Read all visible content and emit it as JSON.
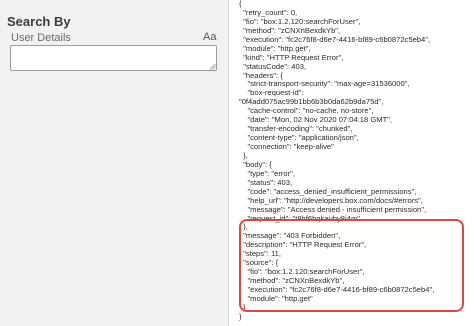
{
  "search_panel": {
    "title": "Search By",
    "field_label": "User Details",
    "case_toggle": "Aa",
    "input_value": ""
  },
  "response_lines": [
    "{",
    "  \"retry_count\": 0,",
    "  \"fio\": \"box:1.2.120:searchForUser\",",
    "  \"method\": \"zCNXnBexdkYb\",",
    "  \"execution\": \"fc2c76f8-d6e7-4416-bf89-c6b0872c5eb4\",",
    "  \"module\": \"http.get\",",
    "  \"kind\": \"HTTP Request Error\",",
    "  \"statusCode\": 403,",
    "  \"headers\": {",
    "    \"strict-transport-security\": \"max-age=31536000\",",
    "    \"box-request-id\":",
    "\"0f4add075ac99b1bb6b3b0da62b9da75d\",",
    "    \"cache-control\": \"no-cache, no-store\",",
    "    \"date\": \"Mon, 02 Nov 2020 07:04:18 GMT\",",
    "    \"transfer-encoding\": \"chunked\",",
    "    \"content-type\": \"application/json\",",
    "    \"connection\": \"keep-alive\"",
    "  },",
    "  \"body\": {",
    "    \"type\": \"error\",",
    "    \"status\": 403,",
    "    \"code\": \"access_denied_insufficient_permissions\",",
    "    \"help_url\": \"http://developers.box.com/docs/#errors\",",
    "    \"message\": \"Access denied - insufficient permission\",",
    "    \"request_id\": \"t8hf6bqkauby8i4m\"",
    "  },",
    "  \"message\": \"403 Forbidden\",",
    "  \"description\": \"HTTP Request Error\",",
    "  \"steps\": 11,",
    "  \"source\": {",
    "    \"fio\": \"box:1.2.120:searchForUser\",",
    "    \"method\": \"zCNXnBexdkYb\",",
    "    \"execution\": \"fc2c76f8-d6e7-4416-bf89-c6b0872c5eb4\",",
    "    \"module\": \"http.get\"",
    "  }",
    "}"
  ],
  "colors": {
    "panel_background": "#f1f1f1",
    "highlight_border": "#e0463e"
  }
}
